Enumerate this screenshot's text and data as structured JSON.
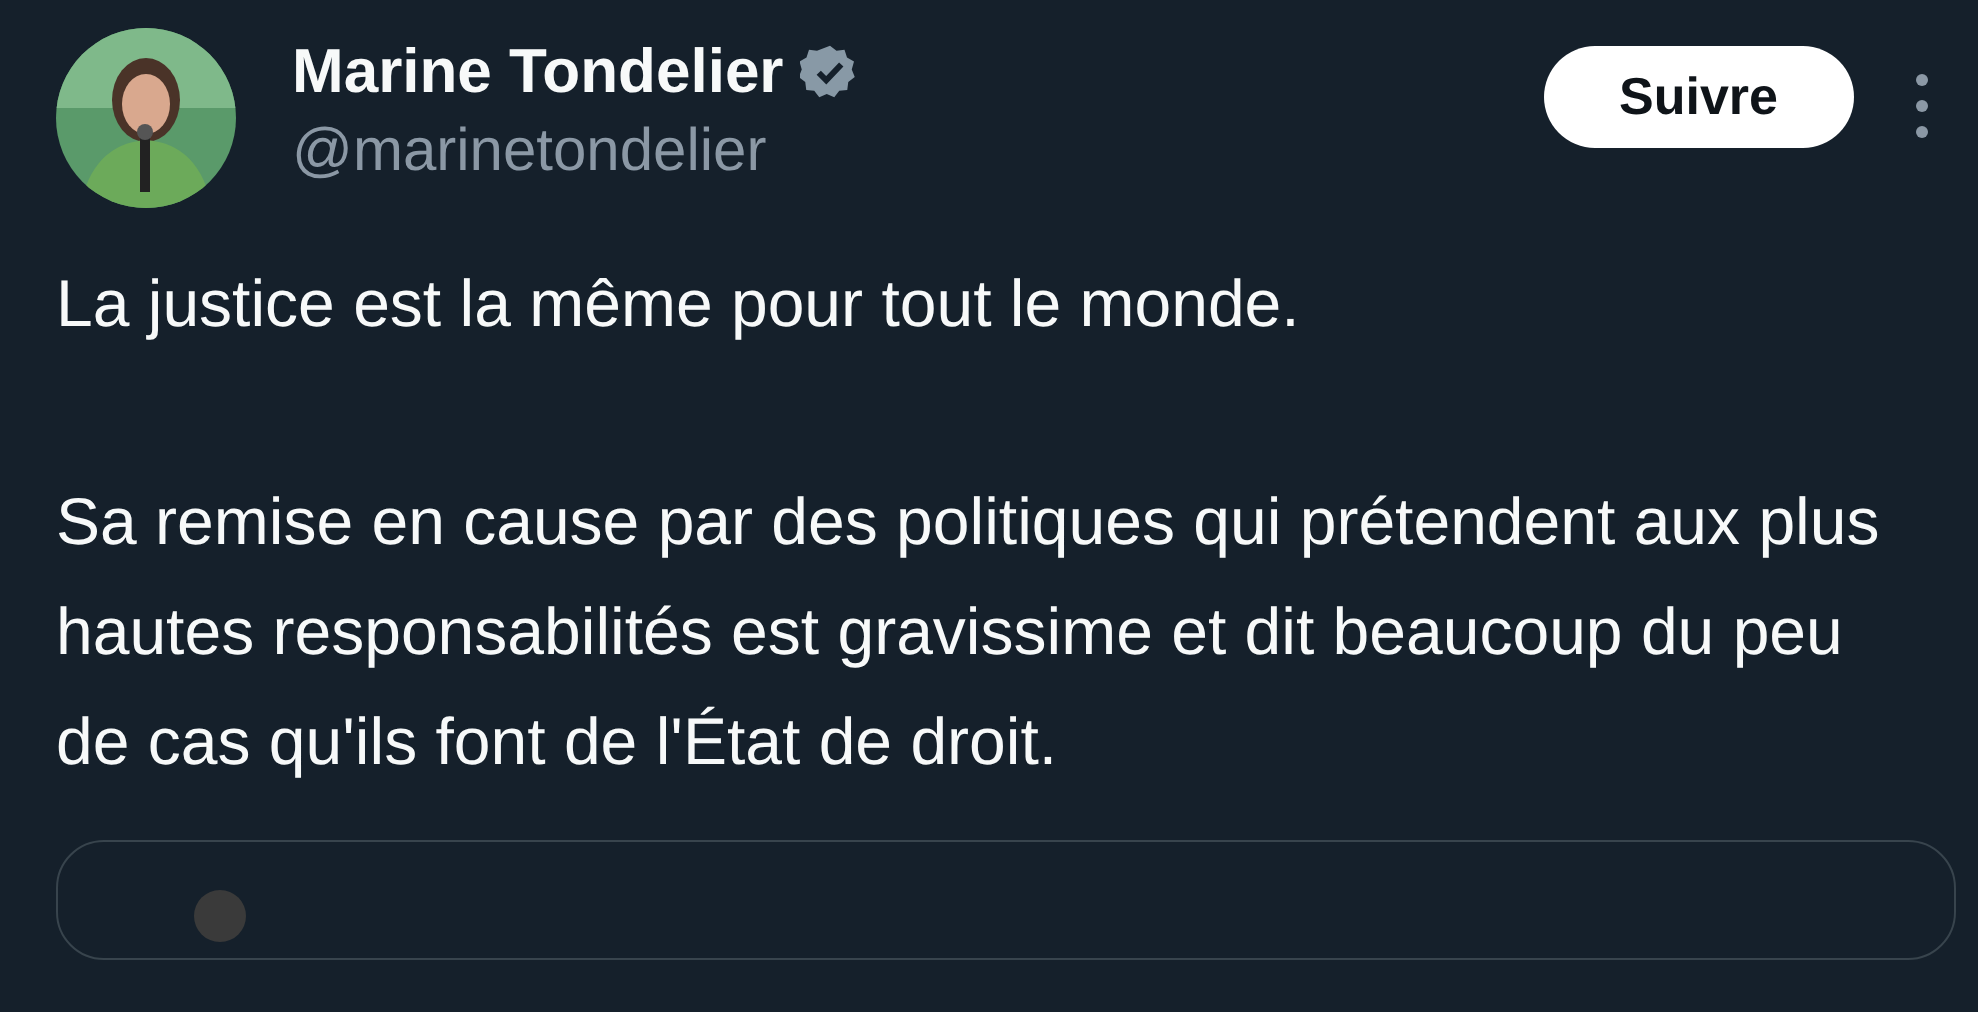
{
  "author": {
    "name": "Marine Tondelier",
    "verified": true,
    "handle": "@marinetondelier"
  },
  "follow_button": "Suivre",
  "paragraphs": [
    "La justice est la même pour tout le monde.",
    "Sa remise en cause par des politiques qui prétendent aux plus hautes responsabilités est gravissime et dit beaucoup du peu de cas qu'ils font de l'État de droit."
  ],
  "quoted_post": {
    "kind": "card"
  }
}
